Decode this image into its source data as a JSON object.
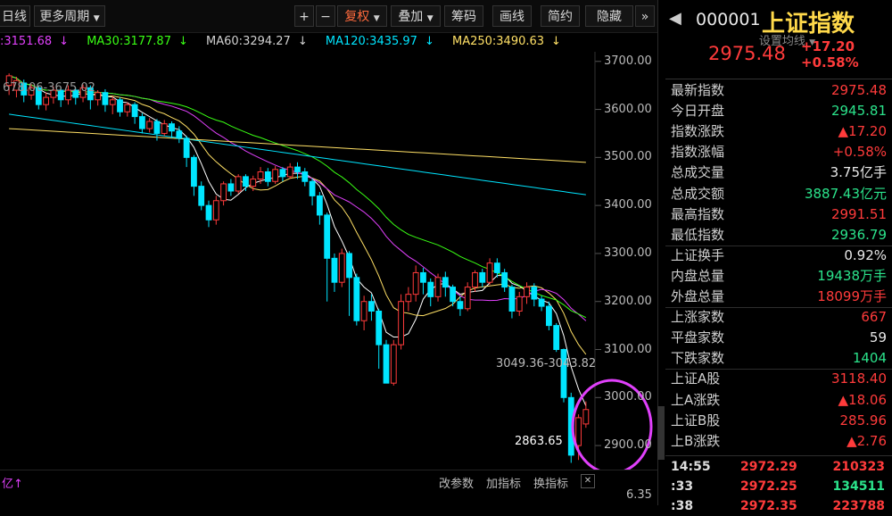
{
  "toolbar": {
    "daily": "日线",
    "more_period": "更多周期",
    "plus": "+",
    "minus": "−",
    "fuquan": "复权",
    "overlay": "叠加",
    "chips": "筹码",
    "draw": "画线",
    "brief": "简约",
    "hide": "隐藏",
    "expand": "»"
  },
  "ma": {
    "ma_prefix": ":3151.68",
    "ma30": "MA30:3177.87",
    "ma60": "MA60:3294.27",
    "ma120": "MA120:3435.97",
    "ma250": "MA250:3490.63",
    "arrow": "↓",
    "set_ma": "设置均线"
  },
  "colors": {
    "ma_prefix": "#e040fb",
    "ma30": "#39ff14",
    "ma60": "#d0d0d0",
    "ma120": "#00e5ff",
    "ma250": "#ffe066",
    "up": "#ff3b3b",
    "down": "#00e5ff"
  },
  "chart": {
    "range_top": "678.06-3675.02",
    "range_right": "3049.36-3043.82",
    "low_label": "2863.65",
    "y_labels": [
      "3700.00",
      "3600.00",
      "3500.00",
      "3400.00",
      "3300.00",
      "3200.00",
      "3100.00",
      "3000.00",
      "2900.00"
    ]
  },
  "bottom": {
    "yi": "亿↑",
    "params": "改参数",
    "add_indicator": "加指标",
    "change_indicator": "换指标",
    "close": "✕",
    "vol_val": "6.35"
  },
  "panel": {
    "code": "000001",
    "name": "上证指数",
    "price": "2975.48",
    "change": "+17.20",
    "change_pct": "+0.58%",
    "rows": [
      {
        "label": "最新指数",
        "value": "2975.48",
        "color": "red"
      },
      {
        "label": "今日开盘",
        "value": "2945.81",
        "color": "green"
      },
      {
        "label": "指数涨跌",
        "value": "▲17.20",
        "color": "red"
      },
      {
        "label": "指数涨幅",
        "value": "+0.58%",
        "color": "red"
      },
      {
        "label": "总成交量",
        "value": "3.75亿手",
        "color": "white"
      },
      {
        "label": "总成交额",
        "value": "3887.43亿元",
        "color": "green"
      },
      {
        "label": "最高指数",
        "value": "2991.51",
        "color": "red"
      },
      {
        "label": "最低指数",
        "value": "2936.79",
        "color": "green"
      },
      {
        "label": "上证换手",
        "value": "0.92%",
        "color": "white"
      },
      {
        "label": "内盘总量",
        "value": "19438万手",
        "color": "green"
      },
      {
        "label": "外盘总量",
        "value": "18099万手",
        "color": "red"
      },
      {
        "label": "上涨家数",
        "value": "667",
        "color": "red"
      },
      {
        "label": "平盘家数",
        "value": "59",
        "color": "white"
      },
      {
        "label": "下跌家数",
        "value": "1404",
        "color": "green"
      },
      {
        "label": "上证A股",
        "value": "3118.40",
        "color": "red"
      },
      {
        "label": "上A涨跌",
        "value": "▲18.06",
        "color": "red"
      },
      {
        "label": "上证B股",
        "value": "285.96",
        "color": "red"
      },
      {
        "label": "上B涨跌",
        "value": "▲2.76",
        "color": "red"
      }
    ],
    "ticks": [
      {
        "time": "14:55",
        "price": "2972.29",
        "vol": "210323"
      },
      {
        "time": ":33",
        "price": "2972.25",
        "vol": "134511"
      },
      {
        "time": ":38",
        "price": "2972.35",
        "vol": "223788"
      }
    ]
  },
  "chart_data": {
    "type": "candlestick",
    "ylim": [
      2850,
      3720
    ],
    "candles": [
      [
        3650,
        3670,
        3630,
        3675
      ],
      [
        3640,
        3660,
        3625,
        3668
      ],
      [
        3655,
        3630,
        3615,
        3662
      ],
      [
        3630,
        3645,
        3620,
        3652
      ],
      [
        3645,
        3610,
        3600,
        3650
      ],
      [
        3610,
        3625,
        3598,
        3635
      ],
      [
        3625,
        3640,
        3612,
        3648
      ],
      [
        3640,
        3620,
        3605,
        3646
      ],
      [
        3620,
        3640,
        3610,
        3650
      ],
      [
        3640,
        3625,
        3610,
        3645
      ],
      [
        3625,
        3645,
        3615,
        3652
      ],
      [
        3645,
        3620,
        3600,
        3650
      ],
      [
        3620,
        3635,
        3608,
        3640
      ],
      [
        3635,
        3610,
        3595,
        3642
      ],
      [
        3610,
        3620,
        3590,
        3628
      ],
      [
        3620,
        3595,
        3585,
        3625
      ],
      [
        3595,
        3610,
        3585,
        3615
      ],
      [
        3610,
        3585,
        3570,
        3615
      ],
      [
        3585,
        3560,
        3550,
        3592
      ],
      [
        3560,
        3575,
        3552,
        3582
      ],
      [
        3575,
        3550,
        3535,
        3580
      ],
      [
        3550,
        3570,
        3545,
        3578
      ],
      [
        3570,
        3555,
        3540,
        3575
      ],
      [
        3555,
        3540,
        3530,
        3565
      ],
      [
        3540,
        3500,
        3480,
        3545
      ],
      [
        3500,
        3440,
        3420,
        3505
      ],
      [
        3440,
        3400,
        3390,
        3450
      ],
      [
        3400,
        3370,
        3355,
        3410
      ],
      [
        3370,
        3410,
        3360,
        3420
      ],
      [
        3410,
        3445,
        3400,
        3450
      ],
      [
        3445,
        3430,
        3420,
        3455
      ],
      [
        3430,
        3460,
        3425,
        3465
      ],
      [
        3460,
        3440,
        3430,
        3465
      ],
      [
        3440,
        3455,
        3430,
        3462
      ],
      [
        3455,
        3470,
        3445,
        3480
      ],
      [
        3470,
        3450,
        3440,
        3478
      ],
      [
        3450,
        3475,
        3445,
        3482
      ],
      [
        3475,
        3460,
        3450,
        3480
      ],
      [
        3460,
        3480,
        3455,
        3488
      ],
      [
        3480,
        3470,
        3455,
        3490
      ],
      [
        3470,
        3450,
        3440,
        3478
      ],
      [
        3450,
        3420,
        3400,
        3456
      ],
      [
        3420,
        3380,
        3360,
        3428
      ],
      [
        3380,
        3290,
        3200,
        3385
      ],
      [
        3290,
        3240,
        3220,
        3300
      ],
      [
        3240,
        3300,
        3230,
        3310
      ],
      [
        3300,
        3250,
        3170,
        3305
      ],
      [
        3250,
        3160,
        3150,
        3258
      ],
      [
        3160,
        3200,
        3140,
        3212
      ],
      [
        3200,
        3180,
        3160,
        3215
      ],
      [
        3180,
        3110,
        3060,
        3185
      ],
      [
        3110,
        3030,
        3030,
        3120
      ],
      [
        3030,
        3110,
        3025,
        3120
      ],
      [
        3110,
        3200,
        3100,
        3215
      ],
      [
        3200,
        3215,
        3180,
        3230
      ],
      [
        3215,
        3260,
        3200,
        3275
      ],
      [
        3260,
        3240,
        3215,
        3270
      ],
      [
        3240,
        3210,
        3190,
        3248
      ],
      [
        3210,
        3250,
        3200,
        3258
      ],
      [
        3250,
        3230,
        3210,
        3262
      ],
      [
        3230,
        3200,
        3190,
        3235
      ],
      [
        3200,
        3185,
        3170,
        3210
      ],
      [
        3185,
        3230,
        3180,
        3240
      ],
      [
        3230,
        3260,
        3220,
        3265
      ],
      [
        3260,
        3240,
        3230,
        3268
      ],
      [
        3240,
        3280,
        3235,
        3290
      ],
      [
        3280,
        3260,
        3250,
        3290
      ],
      [
        3260,
        3230,
        3220,
        3268
      ],
      [
        3230,
        3180,
        3165,
        3235
      ],
      [
        3180,
        3210,
        3170,
        3220
      ],
      [
        3210,
        3230,
        3195,
        3240
      ],
      [
        3230,
        3205,
        3190,
        3238
      ],
      [
        3205,
        3190,
        3180,
        3212
      ],
      [
        3190,
        3150,
        3140,
        3200
      ],
      [
        3150,
        3100,
        3095,
        3155
      ],
      [
        3100,
        3000,
        2990,
        3102
      ],
      [
        3000,
        2880,
        2864,
        3010
      ],
      [
        2900,
        2958,
        2870,
        2965
      ],
      [
        2945,
        2975,
        2937,
        2992
      ]
    ]
  }
}
